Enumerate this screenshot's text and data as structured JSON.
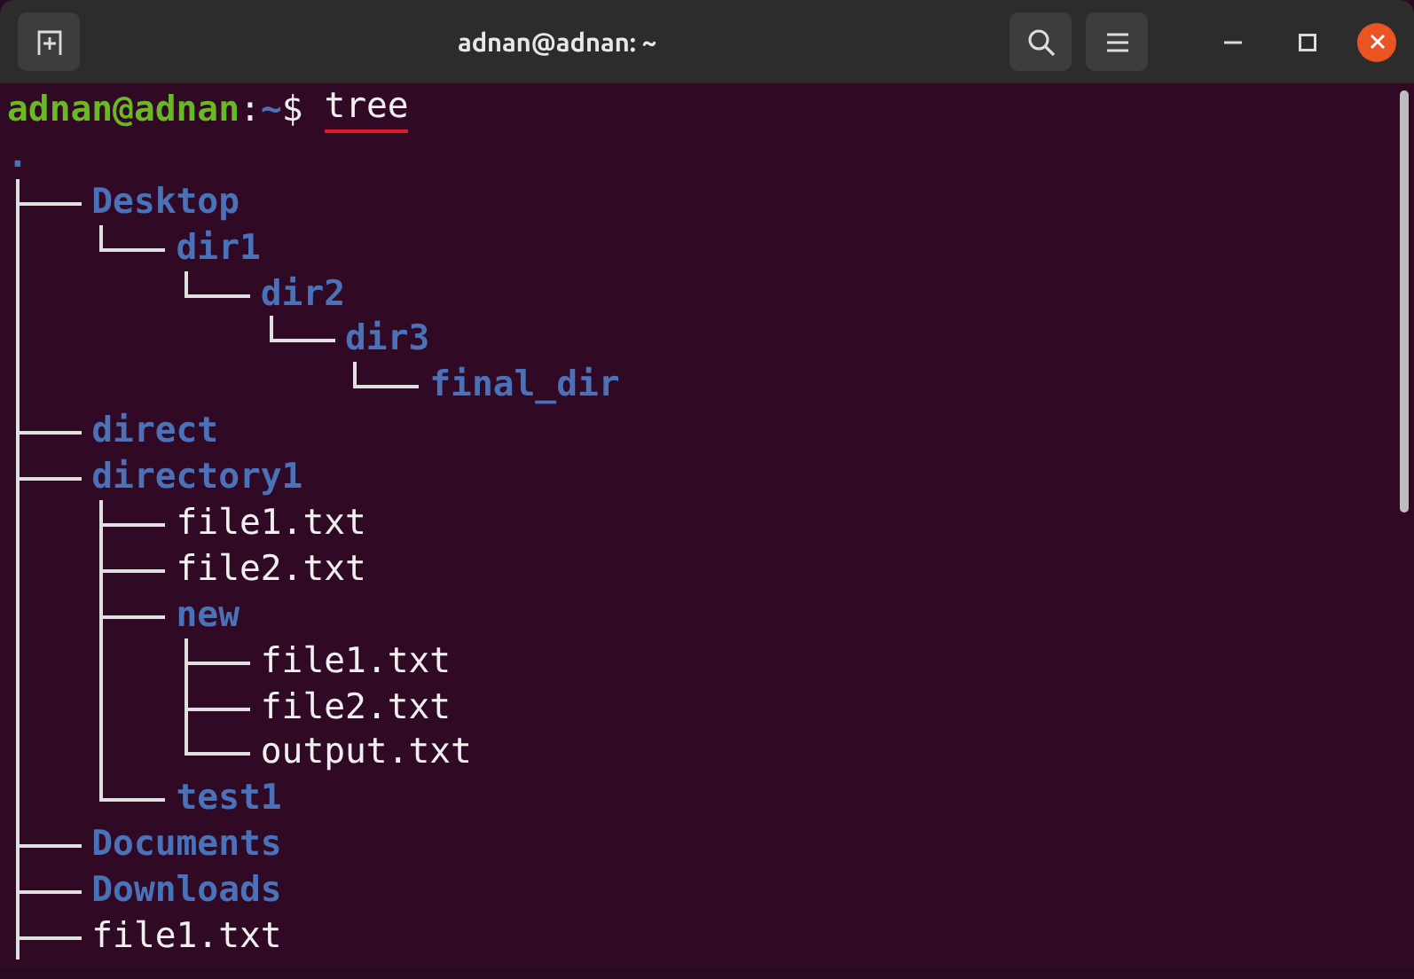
{
  "window": {
    "title": "adnan@adnan: ~"
  },
  "prompt": {
    "user_host": "adnan@adnan",
    "separator": ":",
    "path": "~",
    "symbol": "$",
    "command": "tree",
    "command_flagged": true
  },
  "tree": {
    "root": ".",
    "continues": true,
    "children": [
      {
        "name": "Desktop",
        "kind": "dir",
        "children": [
          {
            "name": "dir1",
            "kind": "dir",
            "children": [
              {
                "name": "dir2",
                "kind": "dir",
                "children": [
                  {
                    "name": "dir3",
                    "kind": "dir",
                    "children": [
                      {
                        "name": "final_dir",
                        "kind": "dir"
                      }
                    ]
                  }
                ]
              }
            ]
          }
        ]
      },
      {
        "name": "direct",
        "kind": "dir"
      },
      {
        "name": "directory1",
        "kind": "dir",
        "children": [
          {
            "name": "file1.txt",
            "kind": "file"
          },
          {
            "name": "file2.txt",
            "kind": "file"
          },
          {
            "name": "new",
            "kind": "dir",
            "children": [
              {
                "name": "file1.txt",
                "kind": "file"
              },
              {
                "name": "file2.txt",
                "kind": "file"
              },
              {
                "name": "output.txt",
                "kind": "file"
              }
            ]
          },
          {
            "name": "test1",
            "kind": "dir"
          }
        ]
      },
      {
        "name": "Documents",
        "kind": "dir"
      },
      {
        "name": "Downloads",
        "kind": "dir"
      },
      {
        "name": "file1.txt",
        "kind": "file"
      }
    ]
  }
}
